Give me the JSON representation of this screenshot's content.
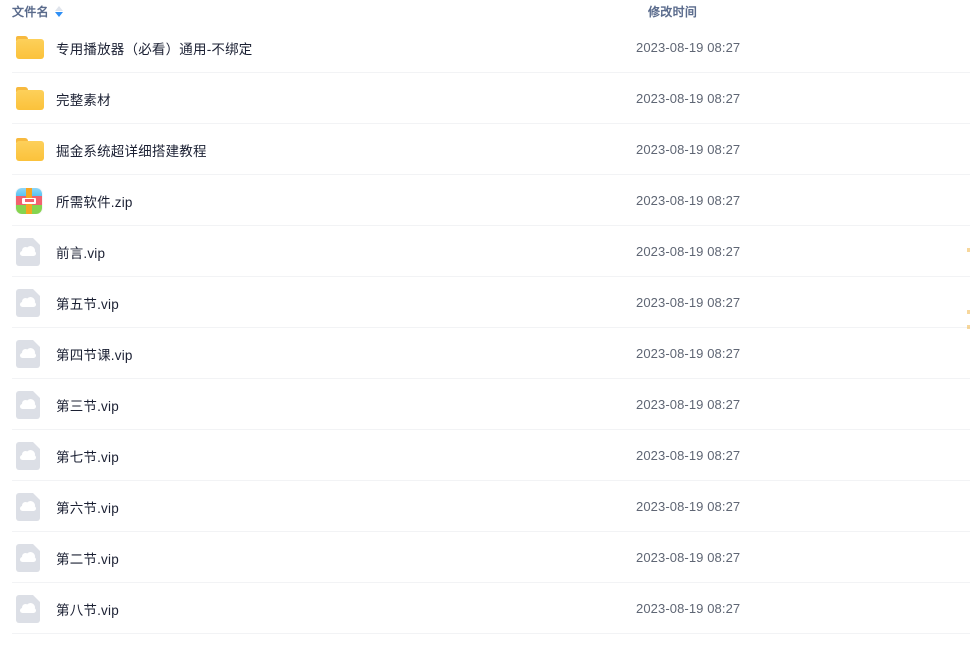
{
  "header": {
    "name_column_label": "文件名",
    "time_column_label": "修改时间",
    "sort_icon": "sort-arrows-icon",
    "sort_direction": "descending"
  },
  "files": [
    {
      "name": "专用播放器（必看）通用-不绑定",
      "modified": "2023-08-19 08:27",
      "type": "folder",
      "icon": "folder-icon"
    },
    {
      "name": "完整素材",
      "modified": "2023-08-19 08:27",
      "type": "folder",
      "icon": "folder-icon"
    },
    {
      "name": "掘金系统超详细搭建教程",
      "modified": "2023-08-19 08:27",
      "type": "folder",
      "icon": "folder-icon"
    },
    {
      "name": "所需软件.zip",
      "modified": "2023-08-19 08:27",
      "type": "archive",
      "icon": "zip-archive-icon"
    },
    {
      "name": "前言.vip",
      "modified": "2023-08-19 08:27",
      "type": "file",
      "icon": "cloud-document-icon"
    },
    {
      "name": "第五节.vip",
      "modified": "2023-08-19 08:27",
      "type": "file",
      "icon": "cloud-document-icon"
    },
    {
      "name": "第四节课.vip",
      "modified": "2023-08-19 08:27",
      "type": "file",
      "icon": "cloud-document-icon"
    },
    {
      "name": "第三节.vip",
      "modified": "2023-08-19 08:27",
      "type": "file",
      "icon": "cloud-document-icon"
    },
    {
      "name": "第七节.vip",
      "modified": "2023-08-19 08:27",
      "type": "file",
      "icon": "cloud-document-icon"
    },
    {
      "name": "第六节.vip",
      "modified": "2023-08-19 08:27",
      "type": "file",
      "icon": "cloud-document-icon"
    },
    {
      "name": "第二节.vip",
      "modified": "2023-08-19 08:27",
      "type": "file",
      "icon": "cloud-document-icon"
    },
    {
      "name": "第八节.vip",
      "modified": "2023-08-19 08:27",
      "type": "file",
      "icon": "cloud-document-icon"
    }
  ],
  "colors": {
    "folder": "#fbc23b",
    "sort_active": "#2e8ff5",
    "sort_inactive": "#dfe4ec",
    "header_text": "#5a6b8c",
    "file_text": "#1b2033",
    "time_text": "#5f6674",
    "row_divider": "#f2f3f5",
    "background": "#ffffff"
  }
}
